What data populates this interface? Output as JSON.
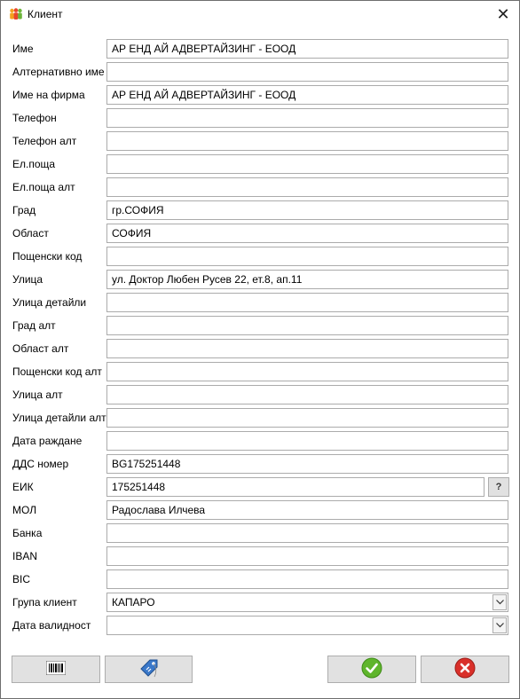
{
  "window": {
    "title": "Клиент",
    "close_glyph": "✕"
  },
  "fields": [
    {
      "label": "Име",
      "value": "АР ЕНД АЙ АДВЕРТАЙЗИНГ - ЕООД"
    },
    {
      "label": "Алтернативно име",
      "value": ""
    },
    {
      "label": "Име на фирма",
      "value": "АР ЕНД АЙ АДВЕРТАЙЗИНГ - ЕООД"
    },
    {
      "label": "Телефон",
      "value": ""
    },
    {
      "label": "Телефон алт",
      "value": ""
    },
    {
      "label": "Ел.поща",
      "value": ""
    },
    {
      "label": "Ел.поща алт",
      "value": ""
    },
    {
      "label": "Град",
      "value": "гр.СОФИЯ"
    },
    {
      "label": "Област",
      "value": "СОФИЯ"
    },
    {
      "label": "Пощенски код",
      "value": ""
    },
    {
      "label": "Улица",
      "value": "ул. Доктор Любен Русев 22, ет.8, ап.11"
    },
    {
      "label": "Улица детайли",
      "value": ""
    },
    {
      "label": "Град алт",
      "value": ""
    },
    {
      "label": "Област алт",
      "value": ""
    },
    {
      "label": "Пощенски код алт",
      "value": ""
    },
    {
      "label": "Улица алт",
      "value": ""
    },
    {
      "label": "Улица детайли алт",
      "value": ""
    },
    {
      "label": "Дата раждане",
      "value": ""
    },
    {
      "label": "ДДС номер",
      "value": "BG175251448"
    },
    {
      "label": "ЕИК",
      "value": "175251448"
    },
    {
      "label": "МОЛ",
      "value": "Радослава Илчева"
    },
    {
      "label": "Банка",
      "value": ""
    },
    {
      "label": "IBAN",
      "value": ""
    },
    {
      "label": "BIC",
      "value": ""
    },
    {
      "label": "Група клиент",
      "value": "КАПАРО"
    },
    {
      "label": "Дата валидност",
      "value": ""
    }
  ],
  "eik_lookup_label": "?",
  "icons": {
    "app": "people-icon",
    "barcode": "barcode-icon",
    "tag": "price-tag-icon",
    "ok": "checkmark-icon",
    "cancel": "cancel-icon"
  },
  "colors": {
    "ok_green": "#5fb52c",
    "cancel_red": "#d9302a",
    "tag_blue": "#3a78c9"
  }
}
